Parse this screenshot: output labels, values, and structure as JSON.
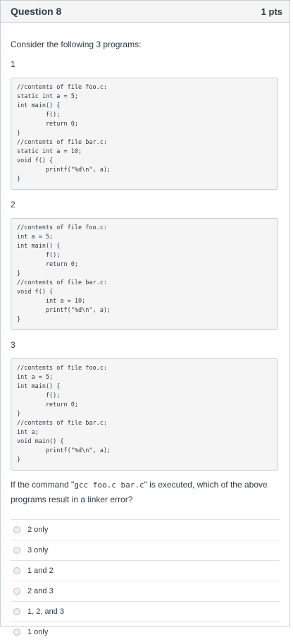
{
  "question": {
    "title": "Question 8",
    "points": "1 pts"
  },
  "intro": "Consider the following 3 programs:",
  "programs": [
    {
      "number": "1",
      "lines": [
        "//contents of file foo.c:",
        "static int a = 5;",
        "int main() {",
        "        f();",
        "        return 0;",
        "}",
        "//contents of file bar.c:",
        "static int a = 10;",
        "void f() {",
        "        printf(\"%d\\n\", a);",
        "}"
      ]
    },
    {
      "number": "2",
      "lines": [
        "//contents of file foo.c:",
        "int a = 5;",
        "int main() {",
        "        f();",
        "        return 0;",
        "}",
        "//contents of file bar.c:",
        "void f() {",
        "        int a = 10;",
        "        printf(\"%d\\n\", a);",
        "}"
      ]
    },
    {
      "number": "3",
      "lines": [
        "//contents of file foo.c:",
        "int a = 5;",
        "int main() {",
        "        f();",
        "        return 0;",
        "}",
        "//contents of file bar.c:",
        "int a;",
        "void main() {",
        "        printf(\"%d\\n\", a);",
        "}"
      ]
    }
  ],
  "prompt": {
    "before": "If the command \"",
    "command": "gcc foo.c bar.c",
    "after": "\" is executed, which of the above programs result in a linker error?"
  },
  "answers": [
    "2 only",
    "3 only",
    "1 and 2",
    "2 and 3",
    "1, 2, and 3",
    "1 only"
  ]
}
